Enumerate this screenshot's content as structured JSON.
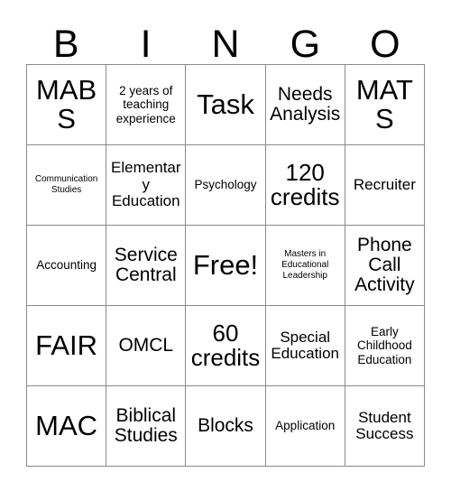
{
  "card": {
    "title": "BINGO",
    "header_letters": [
      "B",
      "I",
      "N",
      "G",
      "O"
    ],
    "grid_size": "5x5",
    "free_space": "Free!",
    "colors": {
      "text": "#000000",
      "border": "#8a8a8a",
      "background": "#ffffff"
    },
    "rows": [
      [
        {
          "label": "MABS",
          "size": "xxl"
        },
        {
          "label": "2 years of teaching experience",
          "size": "s"
        },
        {
          "label": "Task",
          "size": "xxl"
        },
        {
          "label": "Needs Analysis",
          "size": "l"
        },
        {
          "label": "MATS",
          "size": "xxl"
        }
      ],
      [
        {
          "label": "Communication Studies",
          "size": "xs"
        },
        {
          "label": "Elementary Education",
          "size": "m"
        },
        {
          "label": "Psychology",
          "size": "s"
        },
        {
          "label": "120 credits",
          "size": "xl"
        },
        {
          "label": "Recruiter",
          "size": "m"
        }
      ],
      [
        {
          "label": "Accounting",
          "size": "s"
        },
        {
          "label": "Service Central",
          "size": "l"
        },
        {
          "label": "Free!",
          "size": "xxl"
        },
        {
          "label": "Masters in Educational Leadership",
          "size": "xs"
        },
        {
          "label": "Phone Call Activity",
          "size": "l"
        }
      ],
      [
        {
          "label": "FAIR",
          "size": "xxl"
        },
        {
          "label": "OMCL",
          "size": "l"
        },
        {
          "label": "60 credits",
          "size": "xl"
        },
        {
          "label": "Special Education",
          "size": "m"
        },
        {
          "label": "Early Childhood Education",
          "size": "s"
        }
      ],
      [
        {
          "label": "MAC",
          "size": "xxl"
        },
        {
          "label": "Biblical Studies",
          "size": "l"
        },
        {
          "label": "Blocks",
          "size": "l"
        },
        {
          "label": "Application",
          "size": "s"
        },
        {
          "label": "Student Success",
          "size": "m"
        }
      ]
    ]
  }
}
